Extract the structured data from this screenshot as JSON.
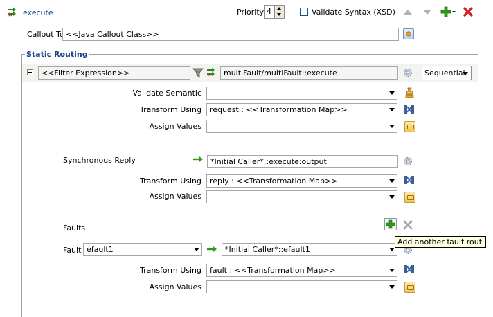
{
  "header": {
    "title": "execute",
    "priority_label": "Priority",
    "priority_value": "4",
    "validate_syntax_label": "Validate Syntax (XSD)",
    "validate_syntax_checked": false
  },
  "callout": {
    "label": "Callout To",
    "value": "<<Java Callout Class>>"
  },
  "static_routing": {
    "title": "Static Routing",
    "filter_expression": "<<Filter Expression>>",
    "target": "multiFault/multiFault::execute",
    "mode": "Sequential"
  },
  "request": {
    "validate_semantic_label": "Validate Semantic",
    "validate_semantic_value": "",
    "transform_label": "Transform Using",
    "transform_value": "request : <<Transformation Map>>",
    "assign_label": "Assign Values",
    "assign_value": ""
  },
  "reply": {
    "label": "Synchronous Reply",
    "target": "*Initial Caller*::execute:output",
    "transform_label": "Transform Using",
    "transform_value": "reply : <<Transformation Map>>",
    "assign_label": "Assign Values",
    "assign_value": ""
  },
  "faults": {
    "title": "Faults",
    "fault_label": "Fault",
    "fault_value": "efault1",
    "target": "*Initial Caller*::efault1",
    "transform_label": "Transform Using",
    "transform_value": "fault : <<Transformation Map>>",
    "assign_label": "Assign Values",
    "assign_value": "",
    "tooltip": "Add another fault routing."
  },
  "colors": {
    "title_blue": "#15428b",
    "panel_border": "#a0a0a0",
    "add_green": "#2f9a18",
    "delete_red": "#d42020"
  }
}
